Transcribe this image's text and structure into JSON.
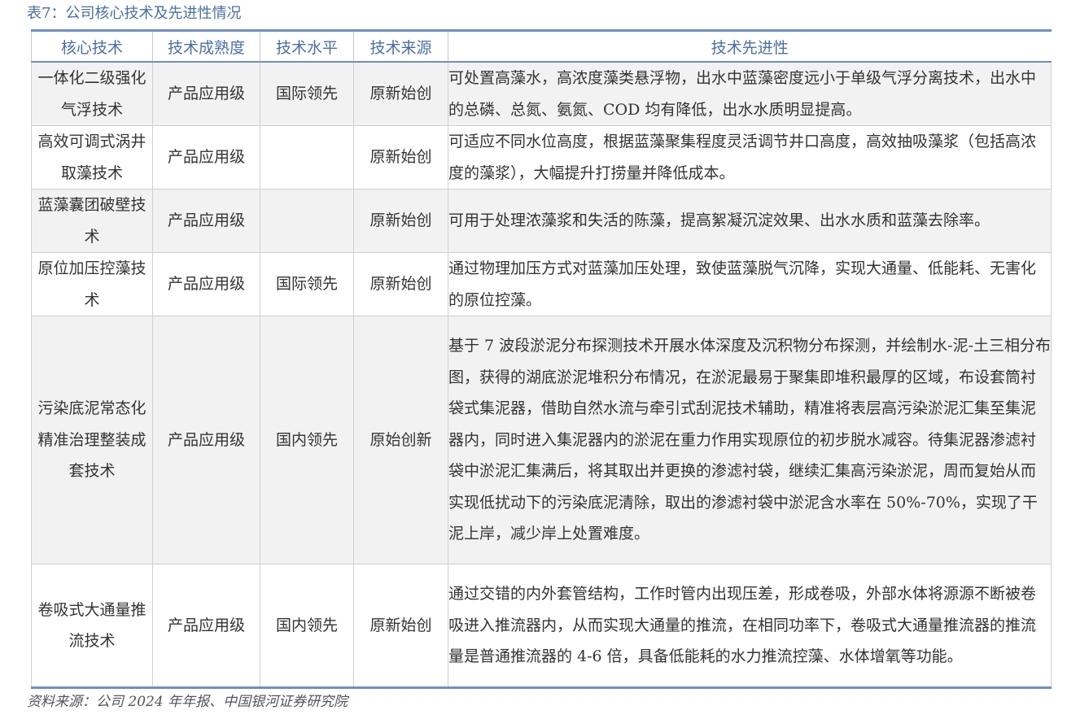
{
  "caption": "表7：公司核心技术及先进性情况",
  "headers": [
    "核心技术",
    "技术成熟度",
    "技术水平",
    "技术来源",
    "技术先进性"
  ],
  "rows": [
    {
      "name": "一体化二级强化气浮技术",
      "maturity": "产品应用级",
      "level": "国际领先",
      "source": "原新始创",
      "desc": "可处置高藻水，高浓度藻类悬浮物，出水中蓝藻密度远小于单级气浮分离技术，出水中的总磷、总氮、氨氮、COD 均有降低，出水水质明显提高。"
    },
    {
      "name": "高效可调式涡井取藻技术",
      "maturity": "产品应用级",
      "level": "",
      "source": "原新始创",
      "desc": "可适应不同水位高度，根据蓝藻聚集程度灵活调节井口高度，高效抽吸藻浆（包括高浓度的藻浆），大幅提升打捞量并降低成本。"
    },
    {
      "name": "蓝藻囊团破壁技术",
      "maturity": "产品应用级",
      "level": "",
      "source": "原新始创",
      "desc": "可用于处理浓藻浆和失活的陈藻，提高絮凝沉淀效果、出水水质和蓝藻去除率。"
    },
    {
      "name": "原位加压控藻技术",
      "maturity": "产品应用级",
      "level": "国际领先",
      "source": "原新始创",
      "desc": "通过物理加压方式对蓝藻加压处理，致使蓝藻脱气沉降，实现大通量、低能耗、无害化的原位控藻。"
    },
    {
      "name": "污染底泥常态化精准治理整装成套技术",
      "maturity": "产品应用级",
      "level": "国内领先",
      "source": "原始创新",
      "desc": "基于 7 波段淤泥分布探测技术开展水体深度及沉积物分布探测，并绘制水-泥-土三相分布图，获得的湖底淤泥堆积分布情况，在淤泥最易于聚集即堆积最厚的区域，布设套筒衬袋式集泥器，借助自然水流与牵引式刮泥技术辅助，精准将表层高污染淤泥汇集至集泥器内，同时进入集泥器内的淤泥在重力作用实现原位的初步脱水减容。待集泥器渗滤衬袋中淤泥汇集满后，将其取出并更换的渗滤衬袋，继续汇集高污染淤泥，周而复始从而实现低扰动下的污染底泥清除，取出的渗滤衬袋中淤泥含水率在 50%-70%，实现了干泥上岸，减少岸上处置难度。"
    },
    {
      "name": "卷吸式大通量推流技术",
      "maturity": "产品应用级",
      "level": "国内领先",
      "source": "原新始创",
      "desc": "通过交错的内外套管结构，工作时管内出现压差，形成卷吸，外部水体将源源不断被卷吸进入推流器内，从而实现大通量的推流，在相同功率下，卷吸式大通量推流器的推流量是普通推流器的 4-6 倍，具备低能耗的水力推流控藻、水体增氧等功能。"
    }
  ],
  "source_note": "资料来源：公司 2024 年年报、中国银河证券研究院"
}
